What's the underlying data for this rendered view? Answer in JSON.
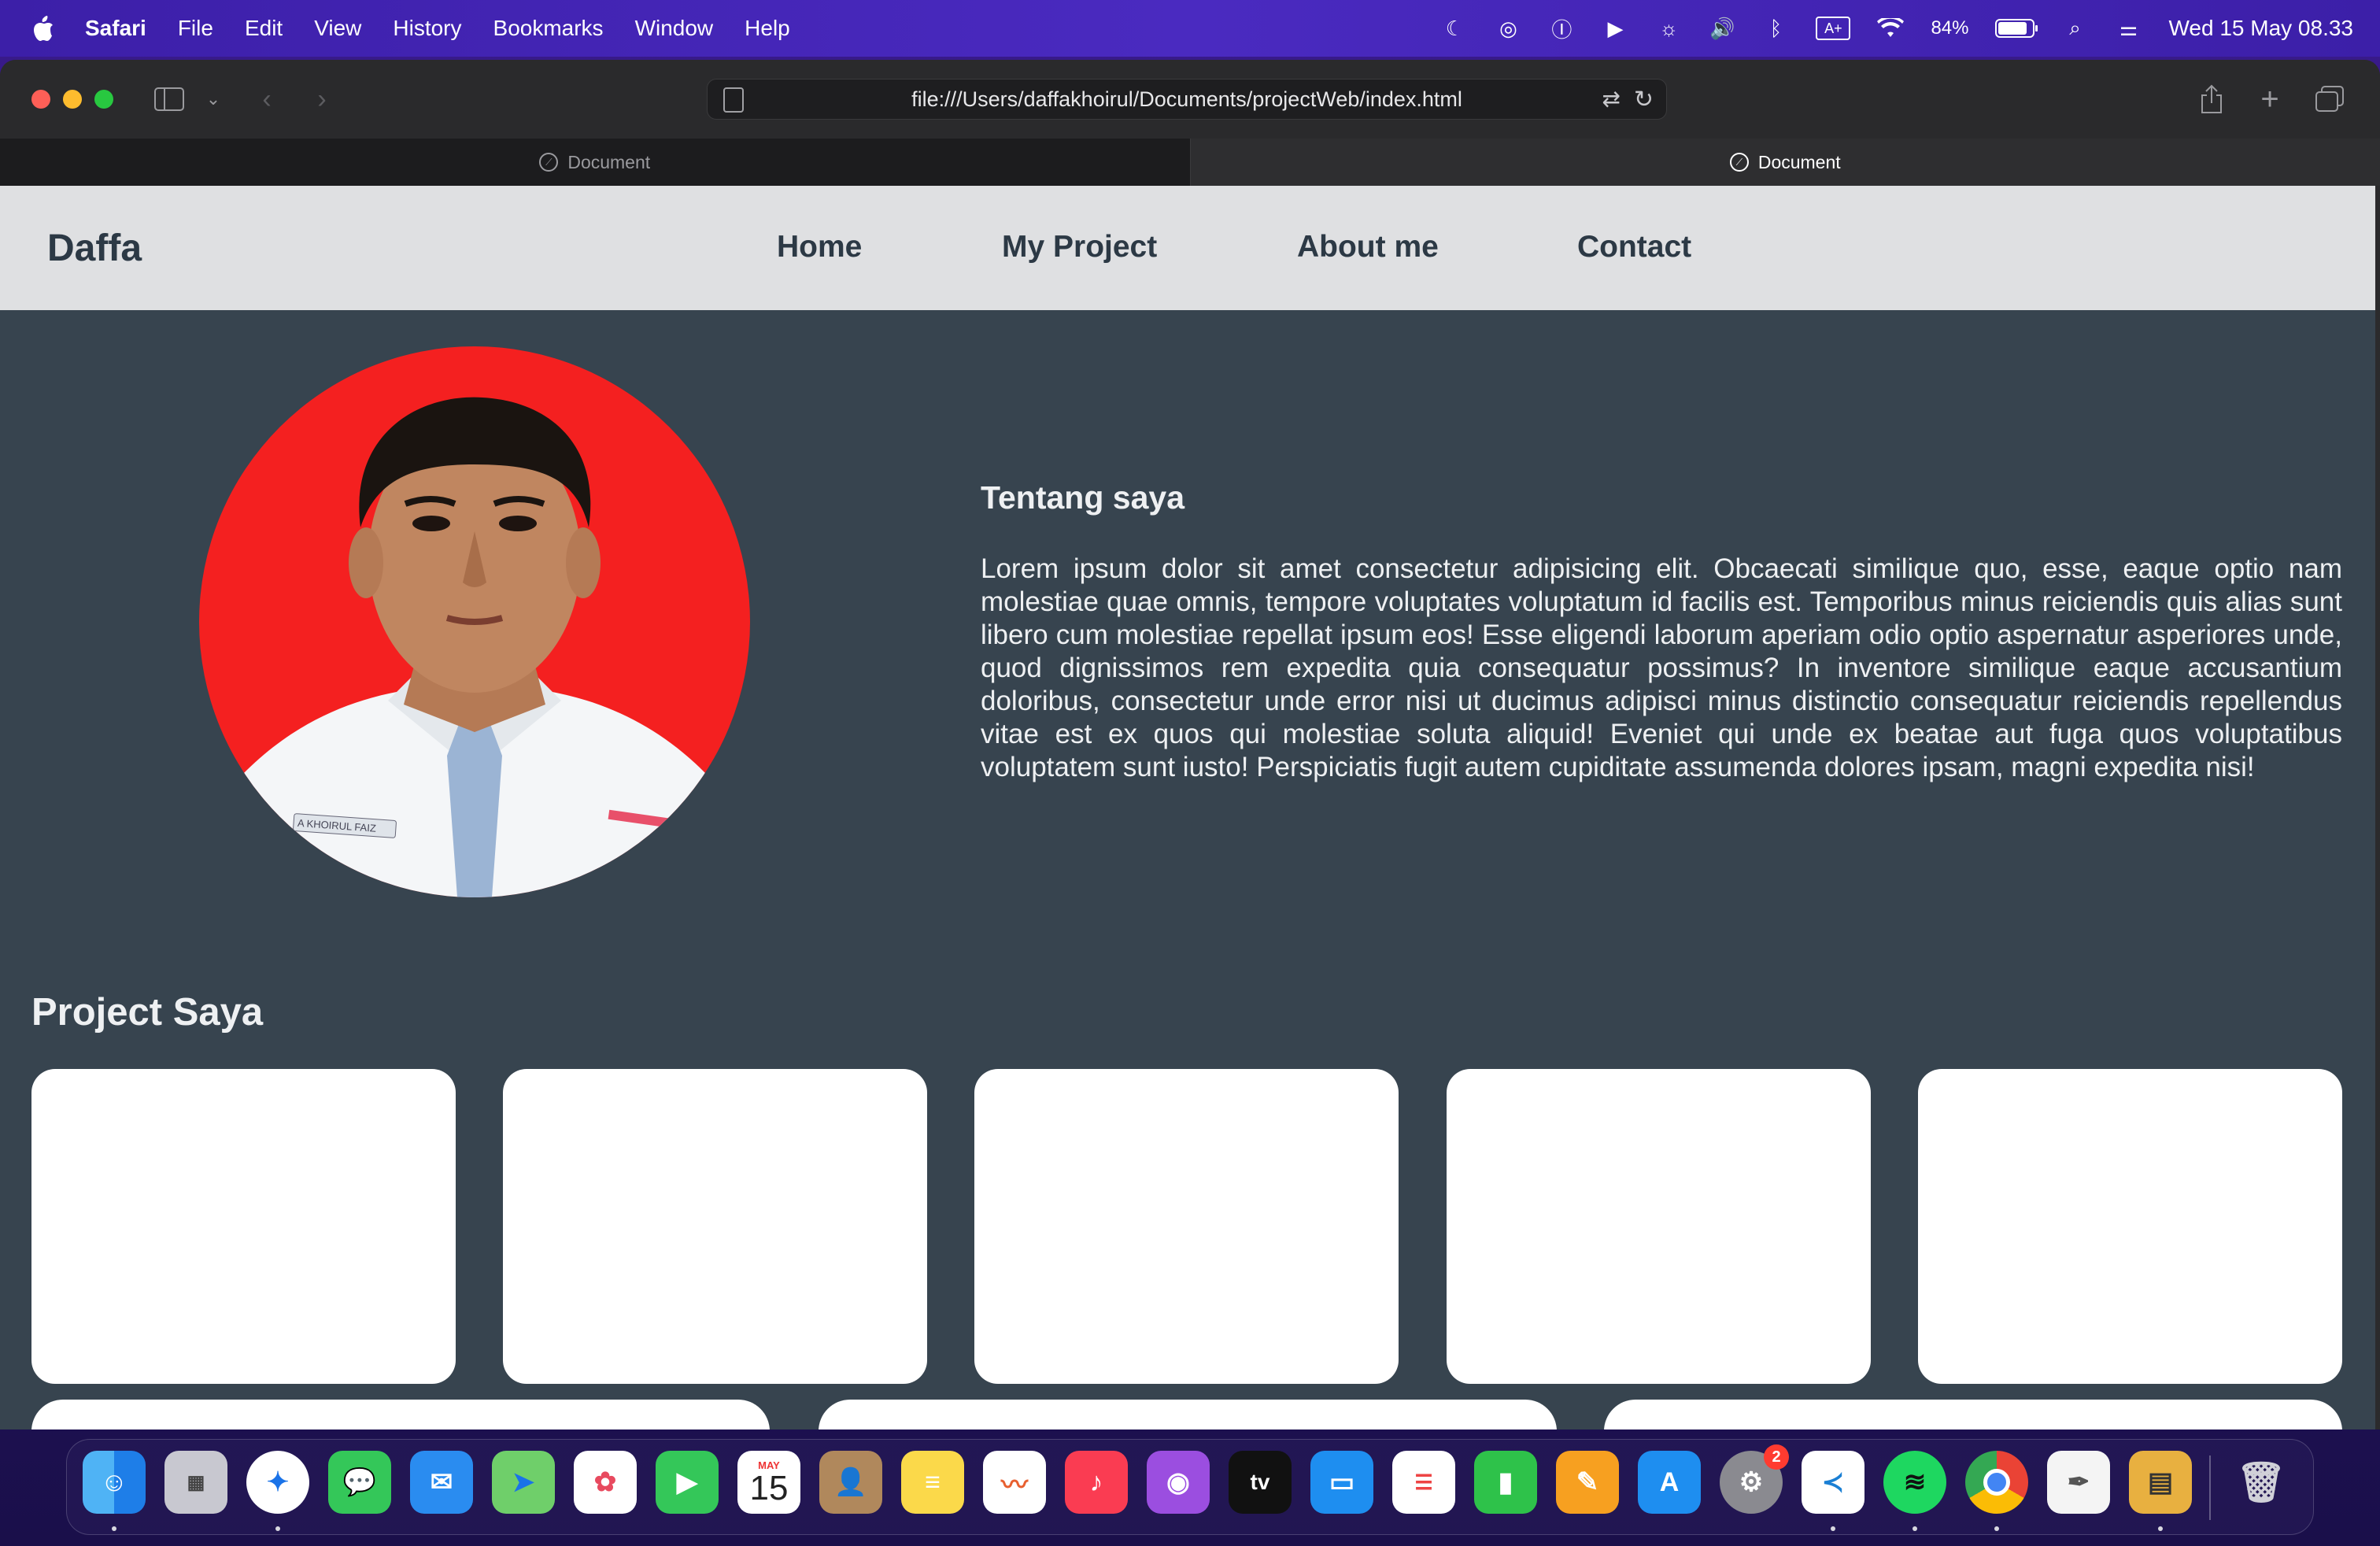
{
  "menubar": {
    "app_name": "Safari",
    "items": [
      "File",
      "Edit",
      "View",
      "History",
      "Bookmarks",
      "Window",
      "Help"
    ],
    "battery_percent": "84%",
    "datetime": "Wed 15 May  08.33"
  },
  "browser": {
    "url": "file:///Users/daffakhoirul/Documents/projectWeb/index.html",
    "tabs": [
      {
        "label": "Document",
        "active": false
      },
      {
        "label": "Document",
        "active": true
      }
    ]
  },
  "site": {
    "brand": "Daffa",
    "nav": [
      "Home",
      "My Project",
      "About me",
      "Contact"
    ],
    "about_title": "Tentang saya",
    "about_text": "Lorem ipsum dolor sit amet consectetur adipisicing elit. Obcaecati similique quo, esse, eaque optio nam molestiae quae omnis, tempore voluptates voluptatum id facilis est. Temporibus minus reiciendis quis alias sunt libero cum molestiae repellat ipsum eos! Esse eligendi laborum aperiam odio optio aspernatur asperiores unde, quod dignissimos rem expedita quia consequatur possimus? In inventore similique eaque accusantium doloribus, consectetur unde error nisi ut ducimus adipisci minus distinctio consequatur reiciendis repellendus vitae est ex quos qui molestiae soluta aliquid! Eveniet qui unde ex beatae aut fuga quos voluptatibus voluptatem sunt iusto! Perspiciatis fugit autem cupiditate assumenda dolores ipsam, magni expedita nisi!",
    "projects_title": "Project Saya",
    "photo_name_tag": "A KHOIRUL FAIZ"
  },
  "dock": {
    "calendar_month": "MAY",
    "calendar_day": "15",
    "appletv_label": "tv",
    "settings_badge": "2",
    "apps": [
      "finder-icon",
      "launchpad-icon",
      "safari-icon",
      "messages-icon",
      "mail-icon",
      "maps-icon",
      "photos-icon",
      "facetime-icon",
      "calendar-icon",
      "contacts-icon",
      "notes-icon",
      "freeform-icon",
      "music-icon",
      "podcasts-icon",
      "appletv-icon",
      "keynote-icon",
      "reminders-icon",
      "numbers-icon",
      "pages-icon",
      "appstore-icon",
      "system-settings-icon",
      "vscode-icon",
      "spotify-icon",
      "chrome-icon",
      "textedit-icon",
      "archive-utility-icon",
      "trash-icon"
    ]
  },
  "colors": {
    "page_bg": "#37444f",
    "nav_bg": "#dfe0e2",
    "nav_text": "#2c3945",
    "photo_bg": "#f42020",
    "menubar_bg": "#4a2ac0"
  }
}
